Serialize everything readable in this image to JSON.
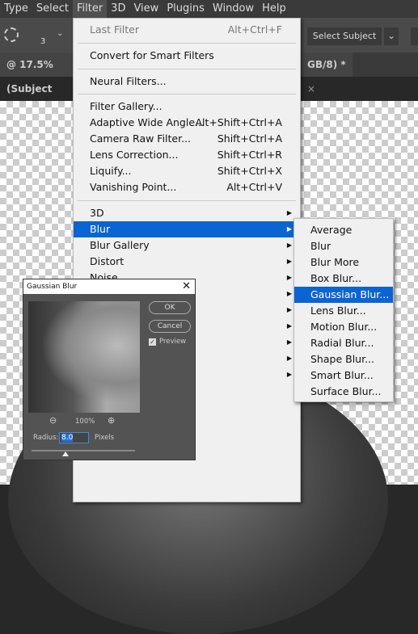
{
  "menubar": [
    "Type",
    "Select",
    "Filter",
    "3D",
    "View",
    "Plugins",
    "Window",
    "Help"
  ],
  "options": {
    "brush_size": "3",
    "select_subject": "Select Subject"
  },
  "tabs": {
    "left": "@ 17.5% (Subject",
    "right": "GB/8) *"
  },
  "filter_menu": {
    "last_filter": {
      "label": "Last Filter",
      "shortcut": "Alt+Ctrl+F"
    },
    "convert": "Convert for Smart Filters",
    "neural": "Neural Filters...",
    "group1": [
      {
        "label": "Filter Gallery...",
        "shortcut": ""
      },
      {
        "label": "Adaptive Wide Angle...",
        "shortcut": "Alt+Shift+Ctrl+A"
      },
      {
        "label": "Camera Raw Filter...",
        "shortcut": "Shift+Ctrl+A"
      },
      {
        "label": "Lens Correction...",
        "shortcut": "Shift+Ctrl+R"
      },
      {
        "label": "Liquify...",
        "shortcut": "Shift+Ctrl+X"
      },
      {
        "label": "Vanishing Point...",
        "shortcut": "Alt+Ctrl+V"
      }
    ],
    "submenus": [
      "3D",
      "Blur",
      "Blur Gallery",
      "Distort",
      "Noise"
    ]
  },
  "blur_submenu": [
    "Average",
    "Blur",
    "Blur More",
    "Box Blur...",
    "Gaussian Blur...",
    "Lens Blur...",
    "Motion Blur...",
    "Radial Blur...",
    "Shape Blur...",
    "Smart Blur...",
    "Surface Blur..."
  ],
  "dialog": {
    "title": "Gaussian Blur",
    "ok": "OK",
    "cancel": "Cancel",
    "preview": "Preview",
    "preview_checked": true,
    "zoom": "100%",
    "radius_label": "Radius:",
    "radius": "8.0",
    "unit": "Pixels",
    "slider_fraction": 0.1
  },
  "colors": {
    "highlight": "#0a64d2"
  }
}
